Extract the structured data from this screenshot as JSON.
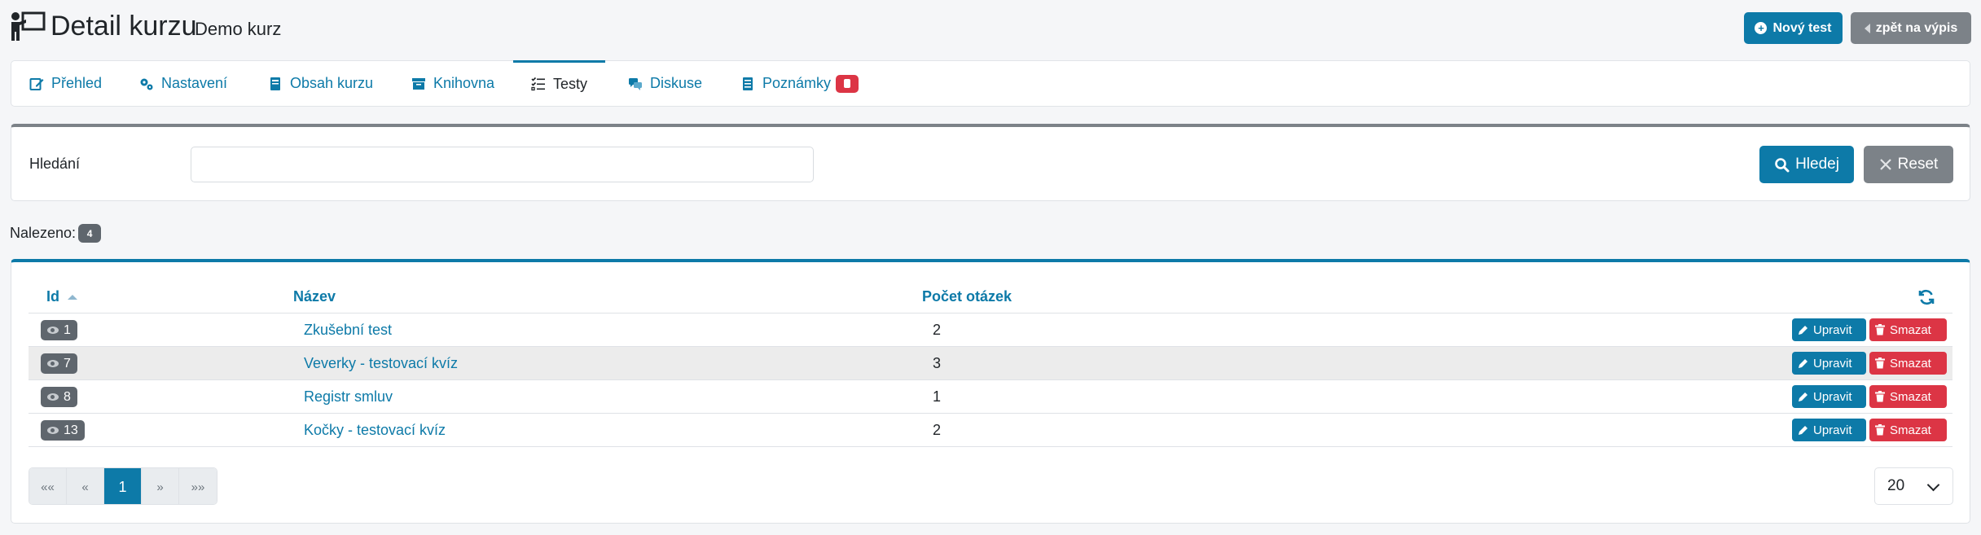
{
  "header": {
    "title": "Detail kurzu",
    "subtitle": "Demo kurz",
    "new_test_label": "Nový test",
    "back_label": "zpět na výpis"
  },
  "tabs": [
    {
      "label": "Přehled",
      "icon": "edit-icon",
      "active": false
    },
    {
      "label": "Nastavení",
      "icon": "gears-icon",
      "active": false
    },
    {
      "label": "Obsah kurzu",
      "icon": "book-icon",
      "active": false
    },
    {
      "label": "Knihovna",
      "icon": "archive-icon",
      "active": false
    },
    {
      "label": "Testy",
      "icon": "checklist-icon",
      "active": true
    },
    {
      "label": "Diskuse",
      "icon": "comments-icon",
      "active": false
    },
    {
      "label": "Poznámky",
      "icon": "notes-icon",
      "active": false,
      "badge_icon": "notes-icon"
    }
  ],
  "search": {
    "label": "Hledání",
    "value": "",
    "placeholder": "",
    "search_label": "Hledej",
    "reset_label": "Reset"
  },
  "found": {
    "label": "Nalezeno:",
    "count": "4"
  },
  "table": {
    "columns": {
      "id": "Id",
      "name": "Název",
      "count": "Počet otázek"
    },
    "edit_label": "Upravit",
    "delete_label": "Smazat",
    "rows": [
      {
        "id": "1",
        "name": "Zkušební test",
        "count": "2"
      },
      {
        "id": "7",
        "name": "Veverky - testovací kvíz",
        "count": "3"
      },
      {
        "id": "8",
        "name": "Registr smluv",
        "count": "1"
      },
      {
        "id": "13",
        "name": "Kočky - testovací kvíz",
        "count": "2"
      }
    ]
  },
  "pagination": {
    "first": "««",
    "prev": "«",
    "current": "1",
    "next": "»",
    "last": "»»",
    "per_page": "20"
  },
  "colors": {
    "primary": "#0d7aa8",
    "danger": "#dc3545",
    "secondary": "#7c8288"
  }
}
